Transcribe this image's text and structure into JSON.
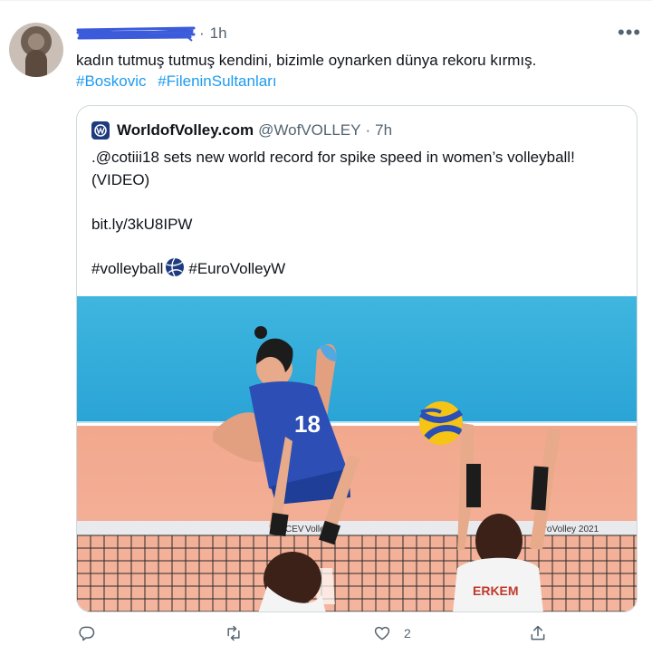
{
  "tweet": {
    "author_name_redacted": "",
    "separator": "·",
    "time": "1h",
    "text": "kadın tutmuş tutmuş kendini, bizimle oynarken dünya rekoru kırmış.",
    "hashtags": [
      "#Boskovic",
      "#FileninSultanları"
    ],
    "more_icon": "more-horizontal-icon"
  },
  "quote": {
    "name": "WorldofVolley.com",
    "handle": "@WofVOLLEY",
    "separator": "·",
    "time": "7h",
    "line1": ".@cotiii18 sets new world record for spike speed in women’s volleyball!",
    "line2": "(VIDEO)",
    "link": "bit.ly/3kU8IPW",
    "tag1": "#volleyball",
    "tag2": "#EuroVolleyW"
  },
  "photo": {
    "jersey_number": "18",
    "banner_left": "CEV",
    "banner_mid": "Volley 2",
    "banner_right": "uroVolley 2021",
    "jersey_name": "ERKEM"
  },
  "actions": {
    "reply_icon": "reply-icon",
    "retweet_icon": "retweet-icon",
    "like_icon": "heart-icon",
    "like_count": "2",
    "share_icon": "share-icon"
  },
  "colors": {
    "accent": "#1d9bf0",
    "text": "#0f1419",
    "muted": "#536471",
    "border": "#cfd9de",
    "redaction": "#3b5bdb"
  }
}
